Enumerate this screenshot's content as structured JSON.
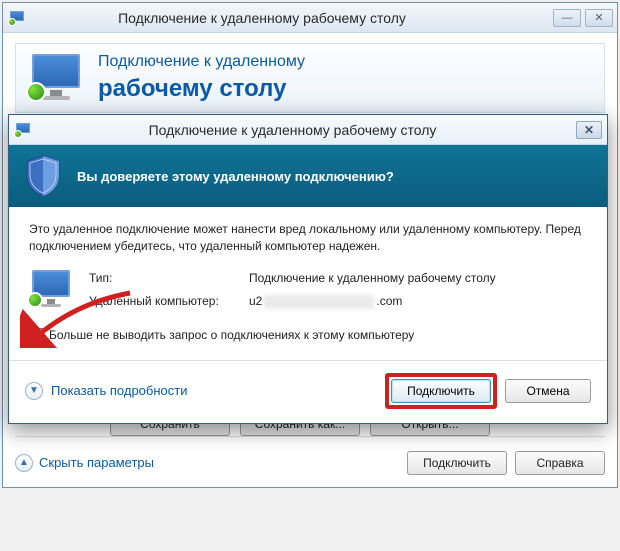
{
  "bg": {
    "title": "Подключение к удаленному рабочему столу",
    "header_line1": "Подключение к удаленному",
    "header_line2": "рабочему столу",
    "btn_save": "Сохранить",
    "btn_save_as": "Сохранить как...",
    "btn_open": "Открыть...",
    "footer_hide": "Скрыть параметры",
    "btn_connect": "Подключить",
    "btn_help": "Справка"
  },
  "dlg": {
    "title": "Подключение к удаленному рабочему столу",
    "question": "Вы доверяете этому удаленному подключению?",
    "warn": "Это удаленное подключение может нанести вред локальному или удаленному компьютеру. Перед подключением убедитесь, что удаленный компьютер надежен.",
    "type_label": "Тип:",
    "type_value": "Подключение к удаленному рабочему столу",
    "remote_label": "Удаленный компьютер:",
    "remote_prefix": "u2",
    "remote_suffix": ".com",
    "cb_label": "Больше не выводить запрос о подключениях к этому компьютеру",
    "show_details": "Показать подробности",
    "connect": "Подключить",
    "cancel": "Отмена"
  }
}
